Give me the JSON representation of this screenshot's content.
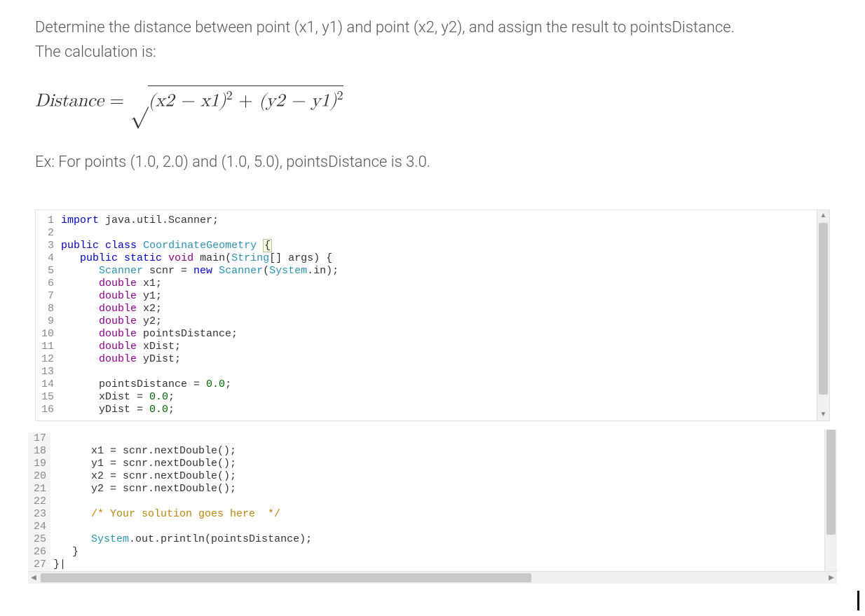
{
  "problem": {
    "line1": "Determine the distance between point (x1, y1) and point (x2, y2), and assign the result to pointsDistance.",
    "line2": "The calculation is:"
  },
  "formula": {
    "lhs": "Distance",
    "equals": " = ",
    "sqrt_symbol": "√",
    "radicand_a": "(x2 − x1)",
    "exp": "2",
    "plus": " + ",
    "radicand_b": "(y2 − y1)",
    "exp2": "2"
  },
  "example": "Ex: For points (1.0, 2.0) and (1.0, 5.0), pointsDistance is 3.0.",
  "code_top": {
    "start": 1,
    "lines": [
      {
        "kind": "code",
        "tokens": [
          [
            "kw",
            "import"
          ],
          [
            "",
            " java.util.Scanner;"
          ]
        ]
      },
      {
        "kind": "blank"
      },
      {
        "kind": "code",
        "tokens": [
          [
            "kw",
            "public"
          ],
          [
            "",
            " "
          ],
          [
            "kw",
            "class"
          ],
          [
            "",
            " "
          ],
          [
            "cls",
            "CoordinateGeometry"
          ],
          [
            "",
            " "
          ],
          [
            "brace",
            "{"
          ]
        ]
      },
      {
        "kind": "code",
        "tokens": [
          [
            "",
            "   "
          ],
          [
            "kw",
            "public"
          ],
          [
            "",
            " "
          ],
          [
            "kw",
            "static"
          ],
          [
            "",
            " "
          ],
          [
            "type",
            "void"
          ],
          [
            "",
            " main("
          ],
          [
            "cls",
            "String"
          ],
          [
            "",
            "[] args) {"
          ]
        ]
      },
      {
        "kind": "code",
        "tokens": [
          [
            "",
            "      "
          ],
          [
            "cls",
            "Scanner"
          ],
          [
            "",
            " scnr = "
          ],
          [
            "kw",
            "new"
          ],
          [
            "",
            " "
          ],
          [
            "cls",
            "Scanner"
          ],
          [
            "",
            "("
          ],
          [
            "cls",
            "System"
          ],
          [
            "",
            ".in);"
          ]
        ]
      },
      {
        "kind": "code",
        "tokens": [
          [
            "",
            "      "
          ],
          [
            "type",
            "double"
          ],
          [
            "",
            " x1;"
          ]
        ]
      },
      {
        "kind": "code",
        "tokens": [
          [
            "",
            "      "
          ],
          [
            "type",
            "double"
          ],
          [
            "",
            " y1;"
          ]
        ]
      },
      {
        "kind": "code",
        "tokens": [
          [
            "",
            "      "
          ],
          [
            "type",
            "double"
          ],
          [
            "",
            " x2;"
          ]
        ]
      },
      {
        "kind": "code",
        "tokens": [
          [
            "",
            "      "
          ],
          [
            "type",
            "double"
          ],
          [
            "",
            " y2;"
          ]
        ]
      },
      {
        "kind": "code",
        "tokens": [
          [
            "",
            "      "
          ],
          [
            "type",
            "double"
          ],
          [
            "",
            " pointsDistance;"
          ]
        ]
      },
      {
        "kind": "code",
        "tokens": [
          [
            "",
            "      "
          ],
          [
            "type",
            "double"
          ],
          [
            "",
            " xDist;"
          ]
        ]
      },
      {
        "kind": "code",
        "tokens": [
          [
            "",
            "      "
          ],
          [
            "type",
            "double"
          ],
          [
            "",
            " yDist;"
          ]
        ]
      },
      {
        "kind": "blank"
      },
      {
        "kind": "code",
        "tokens": [
          [
            "",
            "      pointsDistance = "
          ],
          [
            "num",
            "0.0"
          ],
          [
            "",
            ";"
          ]
        ]
      },
      {
        "kind": "code",
        "tokens": [
          [
            "",
            "      xDist = "
          ],
          [
            "num",
            "0.0"
          ],
          [
            "",
            ";"
          ]
        ]
      },
      {
        "kind": "code",
        "tokens": [
          [
            "",
            "      yDist = "
          ],
          [
            "num",
            "0.0"
          ],
          [
            "",
            ";"
          ]
        ]
      }
    ]
  },
  "code_bottom": {
    "start": 17,
    "lines": [
      {
        "kind": "blank"
      },
      {
        "kind": "code",
        "tokens": [
          [
            "",
            "      x1 = scnr.nextDouble();"
          ]
        ]
      },
      {
        "kind": "code",
        "tokens": [
          [
            "",
            "      y1 = scnr.nextDouble();"
          ]
        ]
      },
      {
        "kind": "code",
        "tokens": [
          [
            "",
            "      x2 = scnr.nextDouble();"
          ]
        ]
      },
      {
        "kind": "code",
        "tokens": [
          [
            "",
            "      y2 = scnr.nextDouble();"
          ]
        ]
      },
      {
        "kind": "blank"
      },
      {
        "kind": "code",
        "tokens": [
          [
            "",
            "      "
          ],
          [
            "cmt",
            "/* Your solution goes here  */"
          ]
        ]
      },
      {
        "kind": "blank"
      },
      {
        "kind": "code",
        "tokens": [
          [
            "",
            "      "
          ],
          [
            "cls",
            "System"
          ],
          [
            "",
            ".out.println(pointsDistance);"
          ]
        ]
      },
      {
        "kind": "code",
        "tokens": [
          [
            "",
            "   }"
          ]
        ]
      },
      {
        "kind": "code",
        "tokens": [
          [
            "",
            "}|"
          ]
        ]
      }
    ]
  }
}
